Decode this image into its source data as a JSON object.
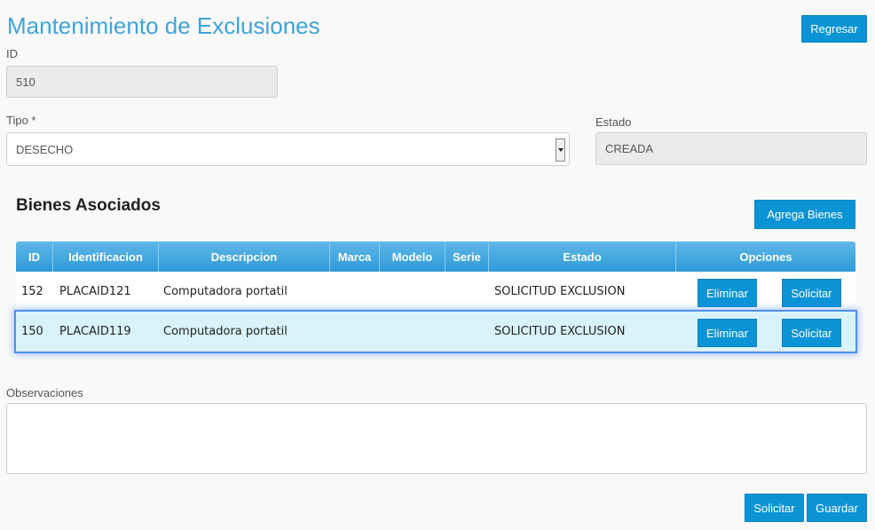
{
  "header": {
    "title": "Mantenimiento de Exclusiones",
    "back_label": "Regresar"
  },
  "form": {
    "id_label": "ID",
    "id_value": "510",
    "tipo_label": "Tipo *",
    "tipo_value": "DESECHO",
    "estado_label": "Estado",
    "estado_value": "CREADA"
  },
  "bienes": {
    "title": "Bienes Asociados",
    "add_label": "Agrega Bienes",
    "columns": [
      "ID",
      "Identificacion",
      "Descripcion",
      "Marca",
      "Modelo",
      "Serie",
      "Estado",
      "Opciones"
    ],
    "rows": [
      {
        "id": "152",
        "identificacion": "PLACAID121",
        "descripcion": "Computadora portatil",
        "marca": "",
        "modelo": "",
        "serie": "",
        "estado": "SOLICITUD EXCLUSION",
        "eliminar": "Eliminar",
        "solicitar": "Solicitar"
      },
      {
        "id": "150",
        "identificacion": "PLACAID119",
        "descripcion": "Computadora portatil",
        "marca": "",
        "modelo": "",
        "serie": "",
        "estado": "SOLICITUD EXCLUSION",
        "eliminar": "Eliminar",
        "solicitar": "Solicitar"
      }
    ]
  },
  "observaciones": {
    "label": "Observaciones",
    "value": ""
  },
  "footer": {
    "solicitar_label": "Solicitar",
    "guardar_label": "Guardar"
  },
  "colors": {
    "accent": "#0a94d6",
    "title": "#3ea3d8",
    "selected_row": "#d9f3fb"
  }
}
